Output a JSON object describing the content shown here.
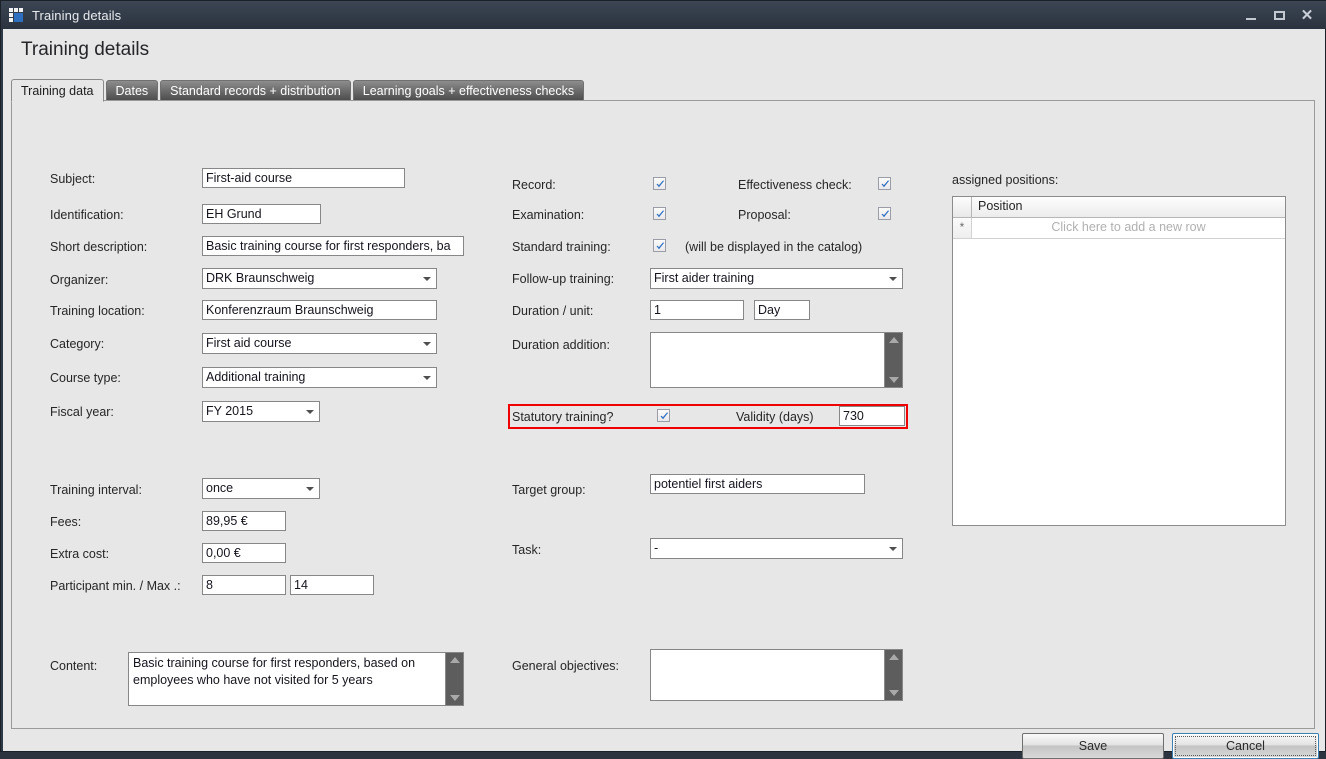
{
  "window": {
    "title": "Training details",
    "icon": "grid-icon",
    "controls": {
      "minimize": "minimize-icon",
      "maximize": "maximize-icon",
      "close": "close-icon"
    }
  },
  "page": {
    "heading": "Training details"
  },
  "tabs": [
    {
      "label": "Training data",
      "active": true
    },
    {
      "label": "Dates",
      "active": false
    },
    {
      "label": "Standard records + distribution",
      "active": false
    },
    {
      "label": "Learning goals + effectiveness checks",
      "active": false
    }
  ],
  "left_column": {
    "subject": {
      "label": "Subject:",
      "value": "First-aid course"
    },
    "identification": {
      "label": "Identification:",
      "value": "EH Grund"
    },
    "short_description": {
      "label": "Short description:",
      "value": "Basic training course for first responders, ba"
    },
    "organizer": {
      "label": "Organizer:",
      "value": "DRK Braunschweig"
    },
    "training_location": {
      "label": "Training location:",
      "value": "Konferenzraum Braunschweig"
    },
    "category": {
      "label": "Category:",
      "value": "First aid course"
    },
    "course_type": {
      "label": "Course type:",
      "value": "Additional training"
    },
    "fiscal_year": {
      "label": "Fiscal year:",
      "value": "FY 2015"
    },
    "training_interval": {
      "label": "Training interval:",
      "value": "once"
    },
    "fees": {
      "label": "Fees:",
      "value": "89,95 €"
    },
    "extra_cost": {
      "label": "Extra cost:",
      "value": "0,00 €"
    },
    "participants": {
      "label": "Participant min. / Max .:",
      "min": "8",
      "max": "14"
    },
    "content": {
      "label": "Content:",
      "value": "Basic training course for first responders, based on employees who have not visited for 5 years"
    }
  },
  "middle_column": {
    "record": {
      "label": "Record:",
      "checked": true
    },
    "effectiveness_check": {
      "label": "Effectiveness check:",
      "checked": true
    },
    "examination": {
      "label": "Examination:",
      "checked": true
    },
    "proposal": {
      "label": "Proposal:",
      "checked": true
    },
    "standard_training": {
      "label": "Standard training:",
      "checked": true,
      "note": "(will be displayed in the catalog)"
    },
    "follow_up_training": {
      "label": "Follow-up training:",
      "value": "First aider training"
    },
    "duration_unit": {
      "label": "Duration / unit:",
      "duration": "1",
      "unit": "Day"
    },
    "duration_addition": {
      "label": "Duration addition:",
      "value": ""
    },
    "statutory_training": {
      "label": "Statutory training?",
      "checked": true,
      "highlighted": true
    },
    "validity_days": {
      "label": "Validity (days)",
      "value": "730"
    },
    "target_group": {
      "label": "Target group:",
      "value": "potentiel first aiders"
    },
    "task": {
      "label": "Task:",
      "value": "-"
    },
    "general_objectives": {
      "label": "General objectives:",
      "value": ""
    }
  },
  "right_panel": {
    "heading": "assigned positions:",
    "grid": {
      "columns": [
        "Position"
      ],
      "rows": [],
      "new_row_text": "Click here to add a new row",
      "new_row_indicator": "*"
    }
  },
  "footer": {
    "save": "Save",
    "cancel": "Cancel",
    "cancel_focused": true
  },
  "colors": {
    "highlight": "#f10000",
    "accent": "#2f6fbf",
    "titlebar": "#333c49",
    "surface": "#e7e7e7"
  }
}
